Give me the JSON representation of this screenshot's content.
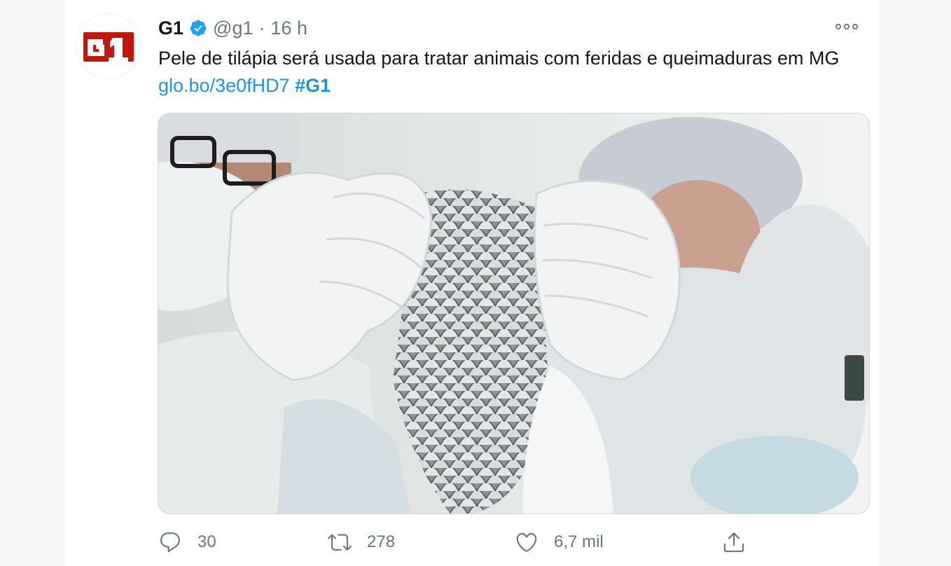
{
  "tweet": {
    "author_name": "G1",
    "handle": "@g1",
    "separator": "·",
    "time": "16 h",
    "text": "Pele de tilápia será usada para tratar animais com feridas e queimaduras em MG",
    "link_text": "glo.bo/3e0fHD7",
    "hashtag": "#G1",
    "avatar_logo_text": "G1",
    "media_alt": "Pessoas de luvas segurando pele de tilápia"
  },
  "actions": {
    "reply_count": "30",
    "retweet_count": "278",
    "like_count": "6,7 mil",
    "reply_icon": "reply-icon",
    "retweet_icon": "retweet-icon",
    "like_icon": "heart-icon",
    "share_icon": "share-icon"
  },
  "colors": {
    "link": "#1b95e0",
    "verified": "#1da1f2",
    "logo_red": "#c4170c",
    "secondary_text": "#657786"
  }
}
